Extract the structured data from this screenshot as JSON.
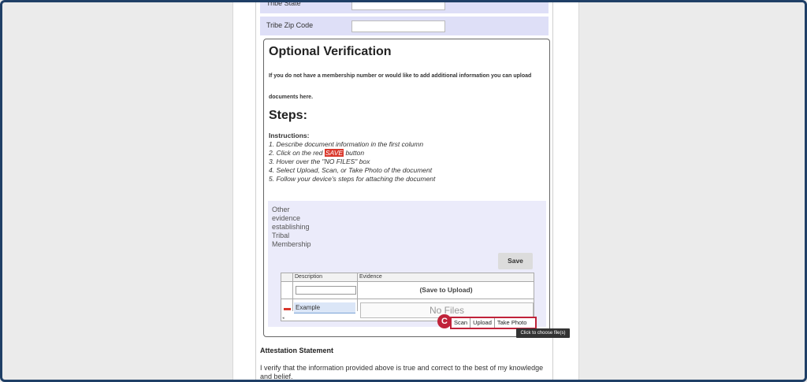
{
  "form": {
    "tribe_state_label": "Tribe State",
    "tribe_zip_label": "Tribe Zip Code"
  },
  "verification": {
    "title": "Optional Verification",
    "intro": "If you do not have a membership number or would like to add additional information you can upload documents here.",
    "steps_title": "Steps:",
    "instructions_label": "Instructions:",
    "step1": "1.  Describe document information in the first column",
    "step2_pre": "2.  Click on the red ",
    "step2_save": "SAVE",
    "step2_post": " button",
    "step3": "3.  Hover over the \"NO FILES\" box",
    "step4": "4.  Select Upload, Scan, or Take Photo of the document",
    "step5": "5.  Follow your device's steps for attaching the document"
  },
  "evidence": {
    "label": "Other evidence establishing Tribal Membership",
    "save_button": "Save",
    "col_description": "Description",
    "col_evidence": "Evidence",
    "save_to_upload": "(Save to Upload)",
    "row_description": "Example",
    "no_files": "No Files",
    "callout": "C",
    "actions": [
      "Scan",
      "Upload",
      "Take Photo"
    ],
    "tooltip": "Click to choose file(s)"
  },
  "attestation": {
    "title": "Attestation Statement",
    "text": "I verify that the information provided above is true and correct to the best of my knowledge and belief."
  }
}
